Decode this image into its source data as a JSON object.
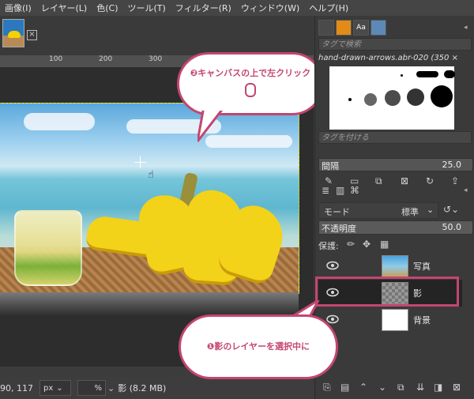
{
  "menubar": {
    "items": [
      "画像(I)",
      "レイヤー(L)",
      "色(C)",
      "ツール(T)",
      "フィルター(R)",
      "ウィンドウ(W)",
      "ヘルプ(H)"
    ]
  },
  "tab": {
    "close_icon": "close-icon"
  },
  "ruler": {
    "labels": [
      "100",
      "200",
      "300"
    ]
  },
  "status": {
    "coords": "90, 117",
    "unit": "px",
    "zoom": "%",
    "text": "影 (8.2 MB)"
  },
  "brushes": {
    "tag_search_placeholder": "タグで検索",
    "brush_name": "hand-drawn-arrows.abr-020 (350 ×",
    "tag_add_placeholder": "タグを付ける",
    "spacing_label": "間隔",
    "spacing_value": "25.0"
  },
  "layers": {
    "mode_label": "モード",
    "mode_value": "標準",
    "opacity_label": "不透明度",
    "opacity_value": "50.0",
    "protect_label": "保護:",
    "items": [
      {
        "name": "写真"
      },
      {
        "name": "影"
      },
      {
        "name": "背景"
      }
    ]
  },
  "callouts": {
    "step1": "❶影のレイヤーを選択中に",
    "step2": "❷キャンバスの上で左クリック"
  },
  "colors": {
    "accent": "#c4466f",
    "selection": "#d8d800"
  }
}
